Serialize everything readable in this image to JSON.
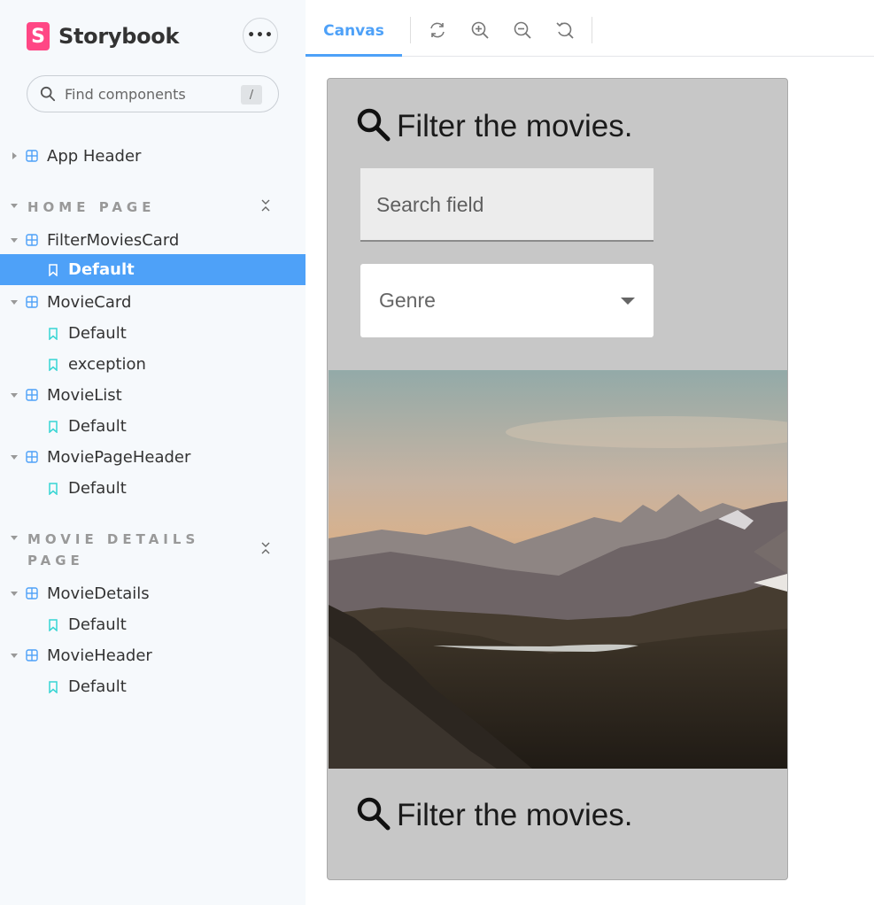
{
  "brand": {
    "name": "Storybook",
    "logo_letter": "S",
    "accent": "#ff4785"
  },
  "menu_button": {
    "label": "•••"
  },
  "search": {
    "placeholder": "Find components",
    "shortcut": "/"
  },
  "sidebar": {
    "top_items": [
      {
        "label": "App Header",
        "type": "component"
      }
    ],
    "sections": [
      {
        "title": "HOME PAGE",
        "items": [
          {
            "label": "FilterMoviesCard",
            "type": "component"
          },
          {
            "label": "Default",
            "type": "story",
            "selected": true
          },
          {
            "label": "MovieCard",
            "type": "component"
          },
          {
            "label": "Default",
            "type": "story"
          },
          {
            "label": "exception",
            "type": "story"
          },
          {
            "label": "MovieList",
            "type": "component"
          },
          {
            "label": "Default",
            "type": "story"
          },
          {
            "label": "MoviePageHeader",
            "type": "component"
          },
          {
            "label": "Default",
            "type": "story"
          }
        ]
      },
      {
        "title_line1": "MOVIE DETAILS",
        "title_line2": "PAGE",
        "items": [
          {
            "label": "MovieDetails",
            "type": "component"
          },
          {
            "label": "Default",
            "type": "story"
          },
          {
            "label": "MovieHeader",
            "type": "component"
          },
          {
            "label": "Default",
            "type": "story"
          }
        ]
      }
    ]
  },
  "toolbar": {
    "tab_canvas": "Canvas",
    "tools": [
      "reload-icon",
      "zoom-in-icon",
      "zoom-out-icon",
      "zoom-reset-icon"
    ],
    "accent": "#4ea1f8"
  },
  "preview": {
    "heading_top": "Filter the movies.",
    "search_placeholder": "Search field",
    "genre_label": "Genre",
    "heading_bottom": "Filter the movies."
  }
}
